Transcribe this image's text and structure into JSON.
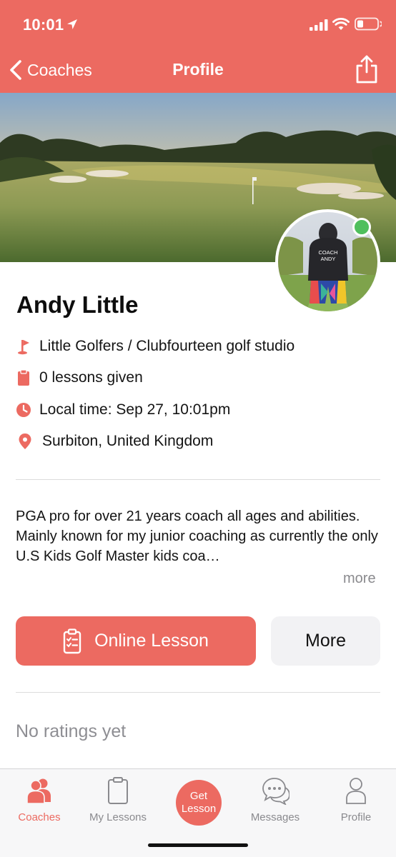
{
  "status_bar": {
    "time": "10:01"
  },
  "nav": {
    "back_label": "Coaches",
    "title": "Profile"
  },
  "coach": {
    "name": "Andy Little",
    "club": "Little Golfers / Clubfourteen golf studio",
    "lessons": "0 lessons given",
    "local_time": "Local time: Sep 27, 10:01pm",
    "location": "Surbiton, United Kingdom",
    "avatar_hoodie_text_line1": "COACH",
    "avatar_hoodie_text_line2": "ANDY"
  },
  "bio": {
    "text": "PGA pro for over 21 years coach all ages and abilities. Mainly known for my junior coaching as currently the only U.S Kids Golf Master kids coa…",
    "more_label": "more"
  },
  "actions": {
    "online_lesson_label": "Online Lesson",
    "more_label": "More"
  },
  "ratings": {
    "empty_label": "No ratings yet"
  },
  "tabbar": {
    "coaches": "Coaches",
    "my_lessons": "My Lessons",
    "get_lesson_line1": "Get",
    "get_lesson_line2": "Lesson",
    "messages": "Messages",
    "profile": "Profile"
  },
  "icons": {
    "back": "chevron-left-icon",
    "share": "share-icon",
    "club": "golf-flag-icon",
    "lessons": "clipboard-icon",
    "time": "clock-icon",
    "location": "map-pin-icon"
  },
  "colors": {
    "brand": "#ec6a61",
    "online": "#4fbf5d",
    "muted_text": "#8e8e93",
    "secondary_button": "#f2f2f4"
  }
}
